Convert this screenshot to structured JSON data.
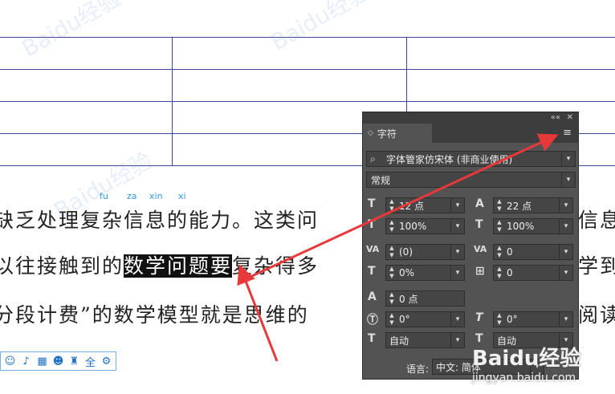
{
  "document": {
    "pinyin": [
      "fu",
      "za",
      "xin",
      "xi"
    ],
    "lines": {
      "line1": "缺乏处理复杂信息的能力。这类问",
      "line1_tail": "信息",
      "line2_pre": "以往接触到的",
      "line2_highlight": "数学问题要",
      "line2_post": "复杂得多",
      "line2_tail": "学到",
      "line3": "分段计费”的数学模型就是思维的",
      "line3_tail": "阅读"
    },
    "watermark": "Baidu经验",
    "watermark_url": "jingyan.baidu.com"
  },
  "ime_toolbar": {
    "icons": [
      "smile-icon",
      "mic-icon",
      "keyboard-icon",
      "user-icon",
      "shirt-icon",
      "grid-icon",
      "settings-icon"
    ]
  },
  "panel": {
    "collapse_label": "««",
    "close_label": "✕",
    "tab_title": "字符",
    "menu_icon": "≡",
    "font_family": "字体管家仿宋体 (非商业使用)",
    "font_style": "常规",
    "font_size": "12 点",
    "leading": "22 点",
    "vertical_scale": "100%",
    "horizontal_scale": "100%",
    "kerning": "(0)",
    "tracking": "0",
    "tsume": "0%",
    "aki": "0",
    "baseline_shift": "0 点",
    "rotation": "0°",
    "skew": "0°",
    "mojikumi_left": "自动",
    "mojikumi_right": "自动",
    "language_label": "语言:",
    "language_value": "中文: 简体"
  },
  "colors": {
    "panel_bg": "#535353",
    "panel_dark": "#3d3d3d",
    "arrow": "#e8393a",
    "pinyin": "#3399dd",
    "table_border": "#3a4a9a"
  }
}
